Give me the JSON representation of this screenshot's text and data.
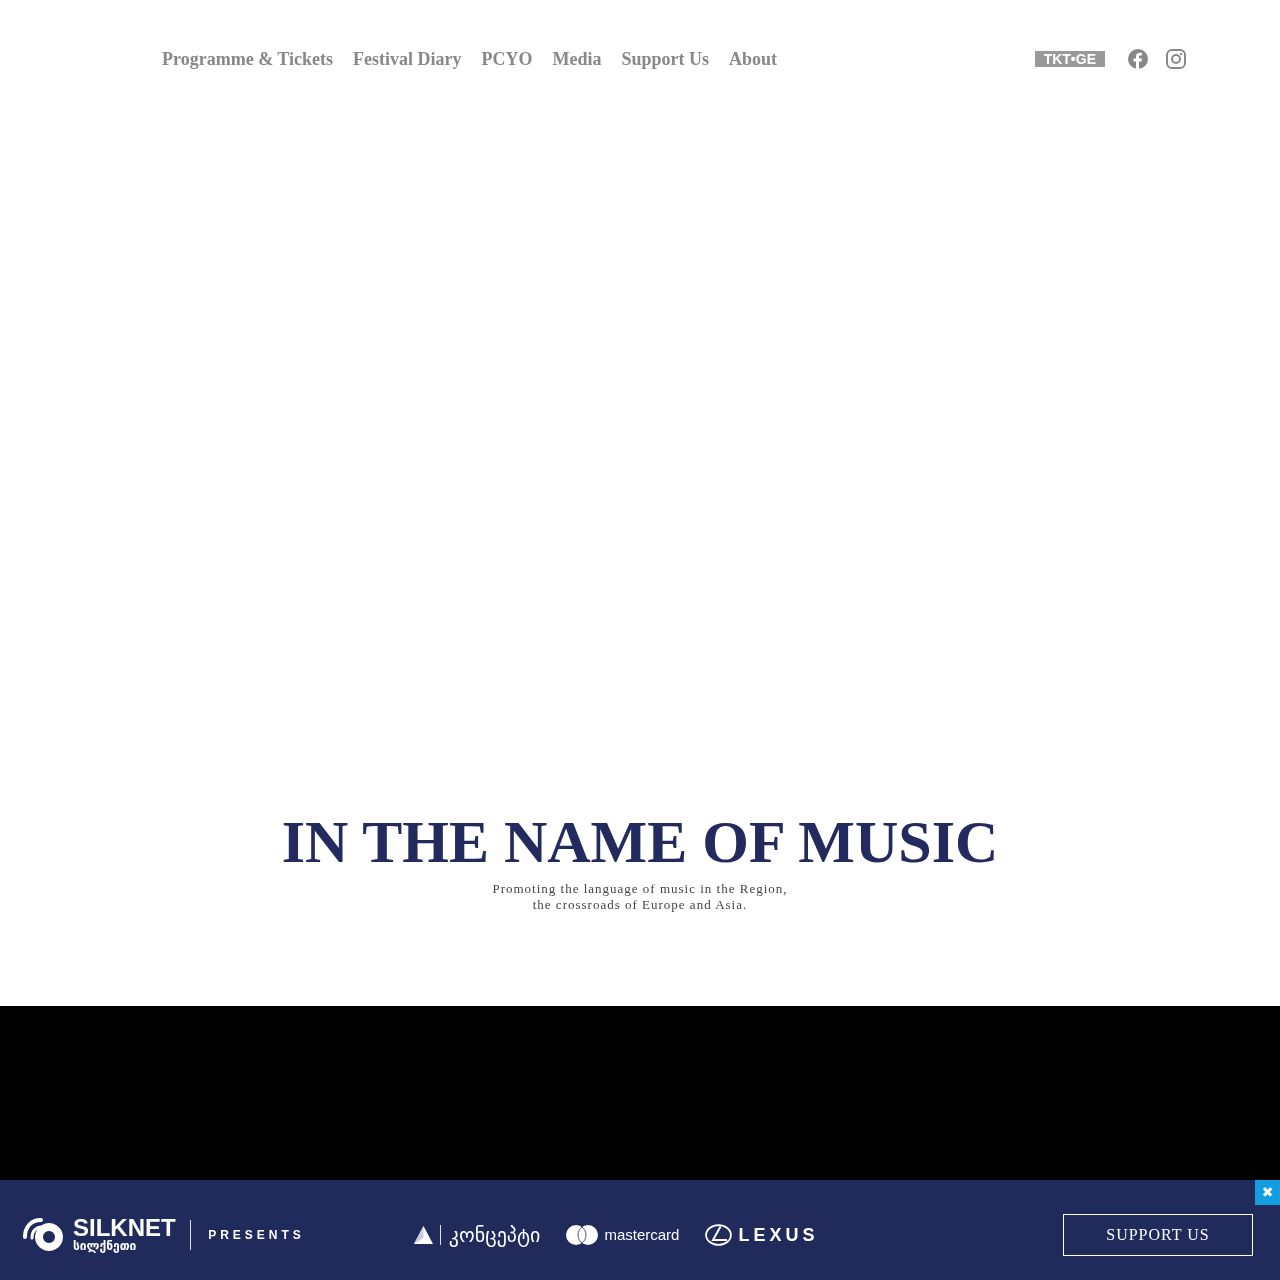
{
  "nav": {
    "links": [
      "Programme & Tickets",
      "Festival Diary",
      "PCYO",
      "Media",
      "Support Us",
      "About"
    ],
    "ticket_logo": "TKT•GE"
  },
  "hero": {
    "title": "IN THE NAME OF MUSIC",
    "subtitle_lines": [
      "Promoting the language of music in the Region,",
      "the crossroads of Europe and Asia."
    ]
  },
  "sponsor_bar": {
    "presenter": {
      "name": "SILKNET",
      "name_georgian": "სილქნეთი"
    },
    "presents": "PRESENTS",
    "sponsors": [
      {
        "kind": "triangle",
        "name": "კონცეპტი"
      },
      {
        "kind": "circles",
        "name": "mastercard"
      },
      {
        "kind": "emblem",
        "name": "LEXUS"
      }
    ],
    "support_button": "SUPPORT US",
    "close_button": "✖"
  }
}
